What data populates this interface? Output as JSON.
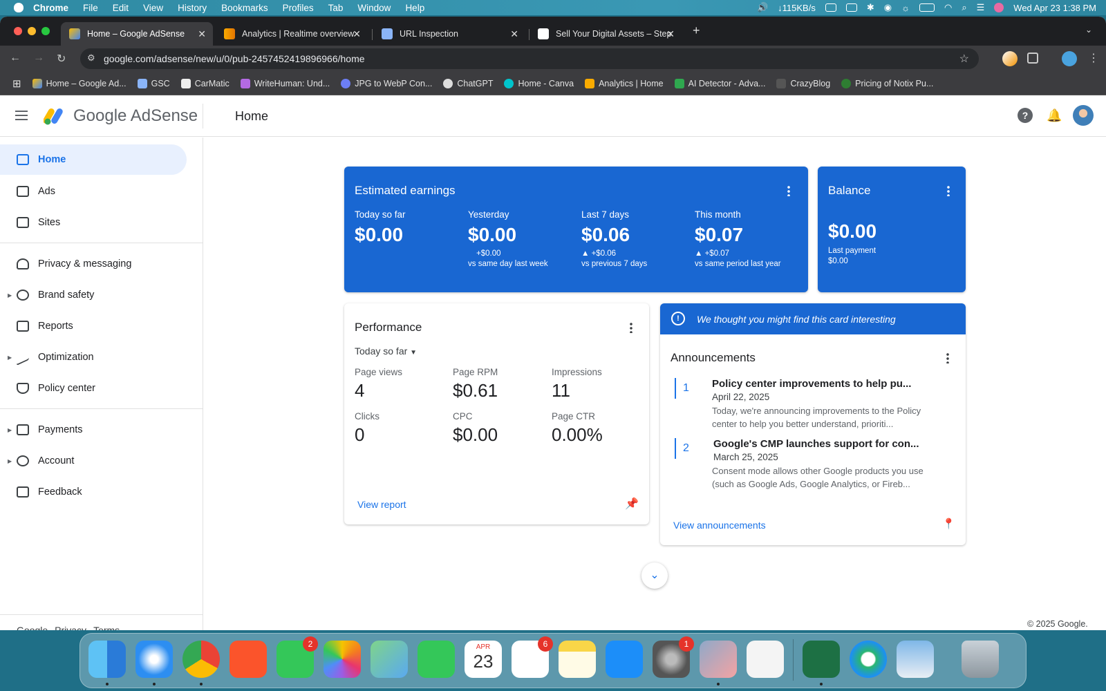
{
  "menubar": {
    "app": "Chrome",
    "items": [
      "File",
      "Edit",
      "View",
      "History",
      "Bookmarks",
      "Profiles",
      "Tab",
      "Window",
      "Help"
    ],
    "net_speed": "↓115KB/s",
    "datetime": "Wed Apr 23  1:38 PM"
  },
  "tabs": [
    {
      "title": "Home – Google AdSense"
    },
    {
      "title": "Analytics | Realtime overview"
    },
    {
      "title": "URL Inspection"
    },
    {
      "title": "Sell Your Digital Assets – Step"
    }
  ],
  "url": "google.com/adsense/new/u/0/pub-2457452419896966/home",
  "bookmarks": [
    "Home – Google Ad...",
    "GSC",
    "CarMatic",
    "WriteHuman: Und...",
    "JPG to WebP Con...",
    "ChatGPT",
    "Home - Canva",
    "Analytics | Home",
    "AI Detector - Adva...",
    "CrazyBlog",
    "Pricing of Notix Pu..."
  ],
  "header": {
    "brand": "Google AdSense",
    "page_title": "Home"
  },
  "sidebar": {
    "items": [
      "Home",
      "Ads",
      "Sites",
      "Privacy & messaging",
      "Brand safety",
      "Reports",
      "Optimization",
      "Policy center",
      "Payments",
      "Account",
      "Feedback"
    ],
    "footer": {
      "google": "Google",
      "privacy": "Privacy",
      "terms": "Terms"
    }
  },
  "earnings": {
    "title": "Estimated earnings",
    "cols": [
      {
        "label": "Today so far",
        "value": "$0.00",
        "delta": "",
        "note": ""
      },
      {
        "label": "Yesterday",
        "value": "$0.00",
        "delta": "+$0.00",
        "note": "vs same day last week"
      },
      {
        "label": "Last 7 days",
        "value": "$0.06",
        "delta": "▲ +$0.06",
        "note": "vs previous 7 days"
      },
      {
        "label": "This month",
        "value": "$0.07",
        "delta": "▲ +$0.07",
        "note": "vs same period last year"
      }
    ]
  },
  "balance": {
    "title": "Balance",
    "value": "$0.00",
    "last_payment_label": "Last payment",
    "last_payment_value": "$0.00"
  },
  "performance": {
    "title": "Performance",
    "range": "Today so far",
    "metrics": [
      {
        "label": "Page views",
        "value": "4"
      },
      {
        "label": "Page RPM",
        "value": "$0.61"
      },
      {
        "label": "Impressions",
        "value": "11"
      },
      {
        "label": "Clicks",
        "value": "0"
      },
      {
        "label": "CPC",
        "value": "$0.00"
      },
      {
        "label": "Page CTR",
        "value": "0.00%"
      }
    ],
    "view_report": "View report"
  },
  "announcements": {
    "banner": "We thought you might find this card interesting",
    "title": "Announcements",
    "items": [
      {
        "num": "1",
        "title": "Policy center improvements to help pu...",
        "date": "April 22, 2025",
        "text": "Today, we're announcing improvements to the Policy center to help you better understand, prioriti..."
      },
      {
        "num": "2",
        "title": "Google's CMP launches support for con...",
        "date": "March 25, 2025",
        "text": "Consent mode allows other Google products you use (such as Google Ads, Google Analytics, or Fireb..."
      }
    ],
    "view_link": "View announcements"
  },
  "copyright": "© 2025 Google.",
  "dock": {
    "messages_badge": "2",
    "reminders_badge": "6",
    "settings_badge": "1",
    "calendar_month": "APR",
    "calendar_day": "23"
  }
}
